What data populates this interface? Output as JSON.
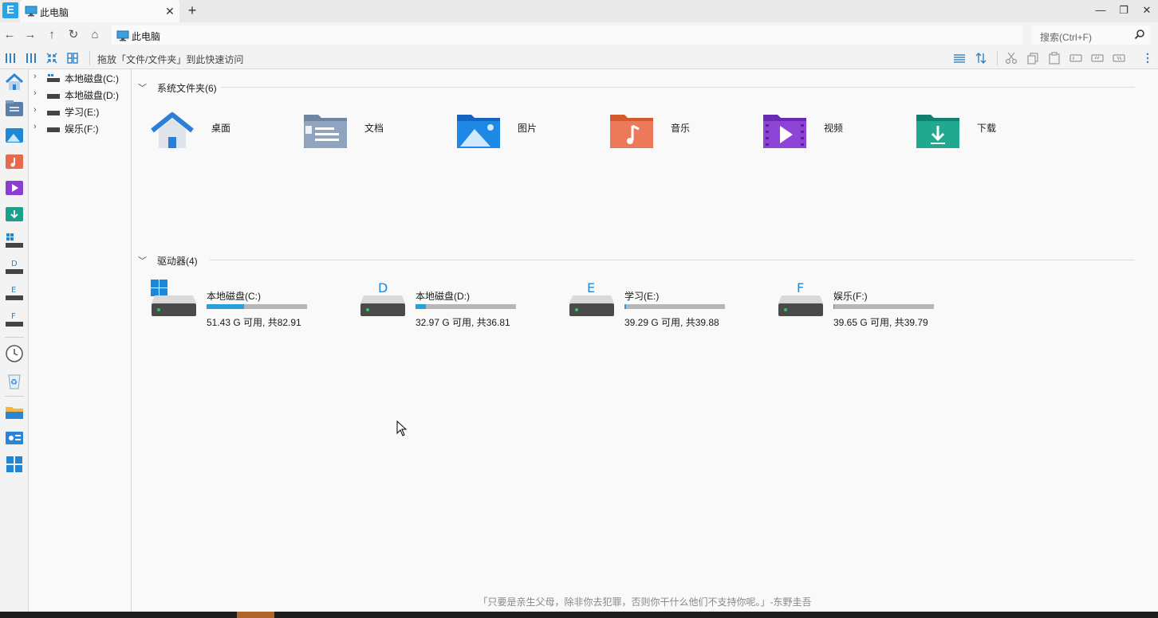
{
  "app": {
    "logo_letter": "E"
  },
  "tab": {
    "title": "此电脑",
    "close": "✕",
    "new_tab": "+"
  },
  "window": {
    "minimize": "—",
    "restore": "❐",
    "close": "✕"
  },
  "nav": {
    "back": "←",
    "forward": "→",
    "up": "↑",
    "refresh": "↻",
    "home": "⌂",
    "address": "此电脑",
    "search_placeholder": "搜索(Ctrl+F)"
  },
  "toolbar": {
    "drop_hint": "拖放「文件/文件夹」到此快速访问"
  },
  "tree": {
    "items": [
      {
        "label": "本地磁盘(C:)",
        "chevron": "›"
      },
      {
        "label": "本地磁盘(D:)",
        "chevron": "›"
      },
      {
        "label": "学习(E:)",
        "chevron": "›"
      },
      {
        "label": "娱乐(F:)",
        "chevron": "›"
      }
    ]
  },
  "main": {
    "folders_title": "系统文件夹(6)",
    "folders": [
      {
        "label": "桌面",
        "icon": "desktop-folder-icon"
      },
      {
        "label": "文档",
        "icon": "documents-folder-icon"
      },
      {
        "label": "图片",
        "icon": "pictures-folder-icon"
      },
      {
        "label": "音乐",
        "icon": "music-folder-icon"
      },
      {
        "label": "视频",
        "icon": "videos-folder-icon"
      },
      {
        "label": "下载",
        "icon": "downloads-folder-icon"
      }
    ],
    "drives_title": "驱动器(4)",
    "drives": [
      {
        "name": "本地磁盘(C:)",
        "letter": "",
        "free": "51.43 G 可用, 共82.91",
        "used_fraction": 0.37
      },
      {
        "name": "本地磁盘(D:)",
        "letter": "D",
        "free": "32.97 G 可用, 共36.81",
        "used_fraction": 0.1
      },
      {
        "name": "学习(E:)",
        "letter": "E",
        "free": "39.29 G 可用, 共39.88",
        "used_fraction": 0.015
      },
      {
        "name": "娱乐(F:)",
        "letter": "F",
        "free": "39.65 G 可用, 共39.79",
        "used_fraction": 0.004
      }
    ],
    "quote": "「只要是亲生父母，除非你去犯罪，否则你干什么他们不支持你呢。」-东野圭吾"
  },
  "colors": {
    "accent": "#26a0da",
    "bar_track": "#b6b6b6"
  }
}
